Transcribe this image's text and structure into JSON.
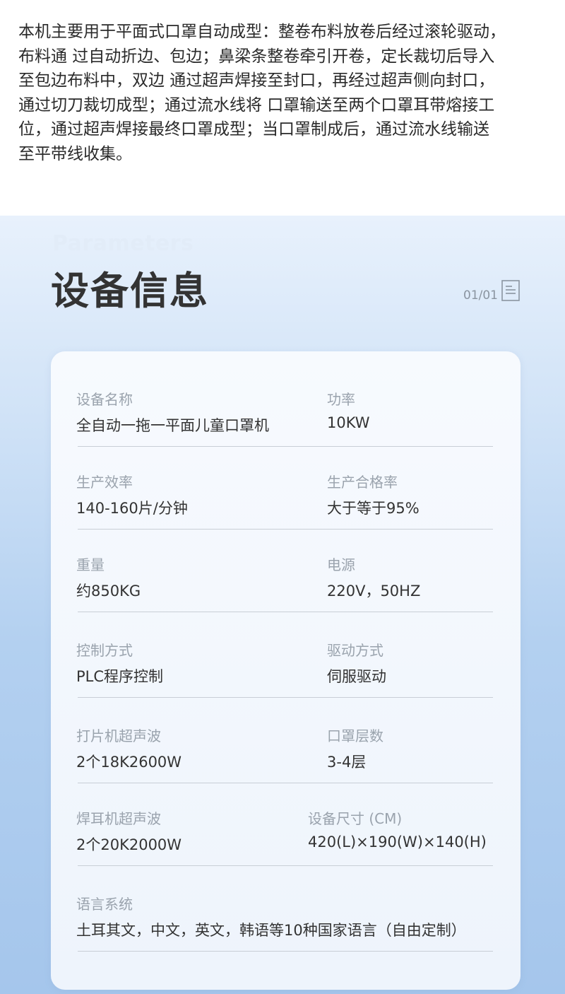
{
  "intro": {
    "lines": [
      "本机主要用于平面式口罩自动成型：整卷布料放卷后经过滚轮驱动，",
      "布料通 过自动折边、包边；鼻梁条整卷牵引开卷，定长裁切后导入",
      "至包边布料中，双边 通过超声焊接至封口，再经过超声侧向封口，",
      "通过切刀裁切成型；通过流水线将 口罩输送至两个口罩耳带熔接工",
      "位，通过超声焊接最终口罩成型；当口罩制成后，通过流水线输送",
      "至平带线收集。"
    ]
  },
  "params": {
    "en_title": "Parameters",
    "cn_title": "设备信息",
    "pager": "01/01",
    "pager_icon": "document-list-icon",
    "rows": [
      {
        "left": {
          "label": "设备名称",
          "value": "全自动一拖一平面儿童口罩机"
        },
        "right": {
          "label": "功率",
          "value": "10KW"
        }
      },
      {
        "left": {
          "label": "生产效率",
          "value": "140-160片/分钟"
        },
        "right": {
          "label": "生产合格率",
          "value": "大于等于95%"
        }
      },
      {
        "left": {
          "label": "重量",
          "value": "约850KG"
        },
        "right": {
          "label": "电源",
          "value": "220V，50HZ"
        }
      },
      {
        "left": {
          "label": "控制方式",
          "value": "PLC程序控制"
        },
        "right": {
          "label": "驱动方式",
          "value": "伺服驱动"
        }
      },
      {
        "left": {
          "label": "打片机超声波",
          "value": "2个18K2600W"
        },
        "right": {
          "label": "口罩层数",
          "value": "3-4层"
        }
      },
      {
        "left": {
          "label": "焊耳机超声波",
          "value": "2个20K2000W"
        },
        "right": {
          "label": "设备尺寸 (CM)",
          "value": "420(L)×190(W)×140(H)"
        }
      },
      {
        "left": {
          "label": "语言系统",
          "value": "土耳其文，中文，英文，韩语等10种国家语言（自由定制）"
        }
      }
    ]
  }
}
